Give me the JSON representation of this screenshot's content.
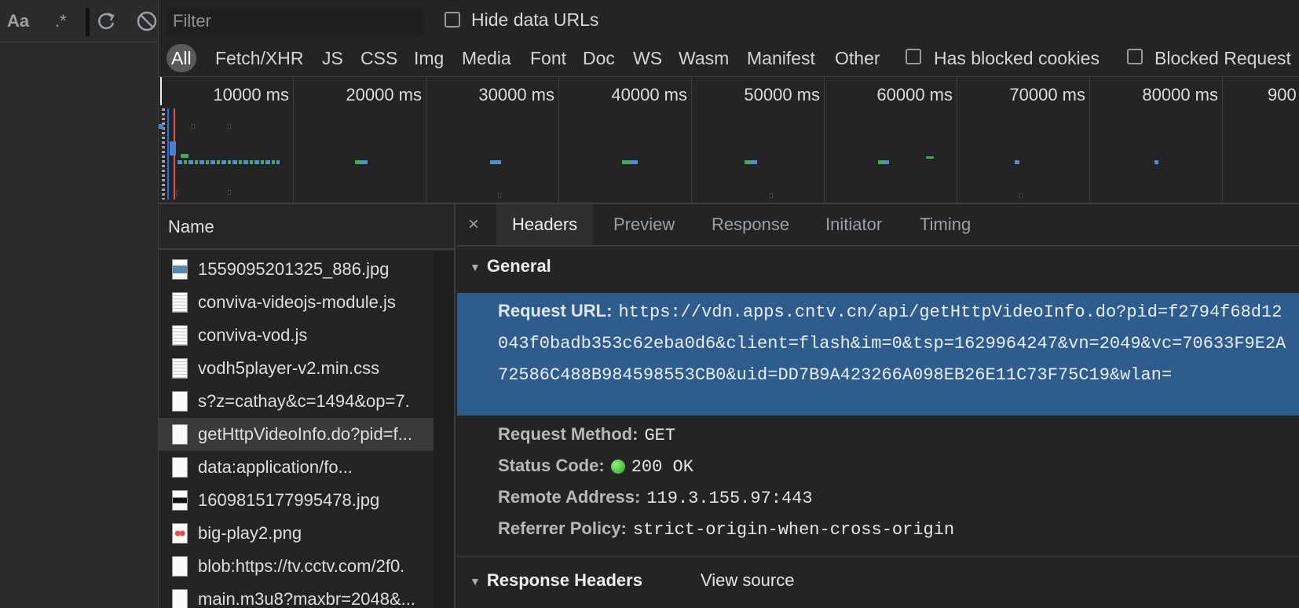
{
  "left_toolbar": {
    "match_case": "Aa",
    "regex": ".*",
    "refresh_icon": "refresh-icon",
    "clear_icon": "clear-icon"
  },
  "filter": {
    "placeholder": "Filter",
    "hide_data_urls": "Hide data URLs"
  },
  "types": {
    "items": [
      "All",
      "Fetch/XHR",
      "JS",
      "CSS",
      "Img",
      "Media",
      "Font",
      "Doc",
      "WS",
      "Wasm",
      "Manifest",
      "Other"
    ],
    "active": "All",
    "has_blocked_cookies": "Has blocked cookies",
    "blocked_requests": "Blocked Request"
  },
  "overview": {
    "ticks": [
      "10000 ms",
      "20000 ms",
      "30000 ms",
      "40000 ms",
      "50000 ms",
      "60000 ms",
      "70000 ms",
      "80000 ms",
      "900"
    ]
  },
  "request_list": {
    "header": "Name",
    "rows": [
      {
        "name": "1559095201325_886.jpg",
        "icon": "image-thumbnail-icon"
      },
      {
        "name": "conviva-videojs-module.js",
        "icon": "script-file-icon"
      },
      {
        "name": "conviva-vod.js",
        "icon": "script-file-icon"
      },
      {
        "name": "vodh5player-v2.min.css",
        "icon": "stylesheet-file-icon"
      },
      {
        "name": "s?z=cathay&c=1494&op=7.",
        "icon": "document-file-icon"
      },
      {
        "name": "getHttpVideoInfo.do?pid=f...",
        "icon": "document-file-icon",
        "selected": true
      },
      {
        "name": "data:application/fo...",
        "icon": "document-file-icon"
      },
      {
        "name": "1609815177995478.jpg",
        "icon": "image-thumbnail-icon"
      },
      {
        "name": "big-play2.png",
        "icon": "image-thumbnail-icon"
      },
      {
        "name": "blob:https://tv.cctv.com/2f0.",
        "icon": "document-file-icon"
      },
      {
        "name": "main.m3u8?maxbr=2048&...",
        "icon": "document-file-icon"
      }
    ]
  },
  "details": {
    "close": "×",
    "tabs": [
      "Headers",
      "Preview",
      "Response",
      "Initiator",
      "Timing"
    ],
    "active_tab": "Headers",
    "general": {
      "title": "General",
      "request_url_label": "Request URL:",
      "request_url": "https://vdn.apps.cntv.cn/api/getHttpVideoInfo.do?pid=f2794f68d12043f0badb353c62eba0d6&client=flash&im=0&tsp=1629964247&vn=2049&vc=70633F9E2A72586C488B984598553CB0&uid=DD7B9A423266A098EB26E11C73F75C19&wlan=",
      "method_label": "Request Method:",
      "method": "GET",
      "status_label": "Status Code:",
      "status": "200 OK",
      "remote_label": "Remote Address:",
      "remote": "119.3.155.97:443",
      "referrer_label": "Referrer Policy:",
      "referrer": "strict-origin-when-cross-origin"
    },
    "response_headers": {
      "title": "Response Headers",
      "view_source": "View source"
    }
  },
  "colors": {
    "selection": "#2e5d8d",
    "status_ok": "#3cb53c",
    "accent": "#1a73e8"
  }
}
